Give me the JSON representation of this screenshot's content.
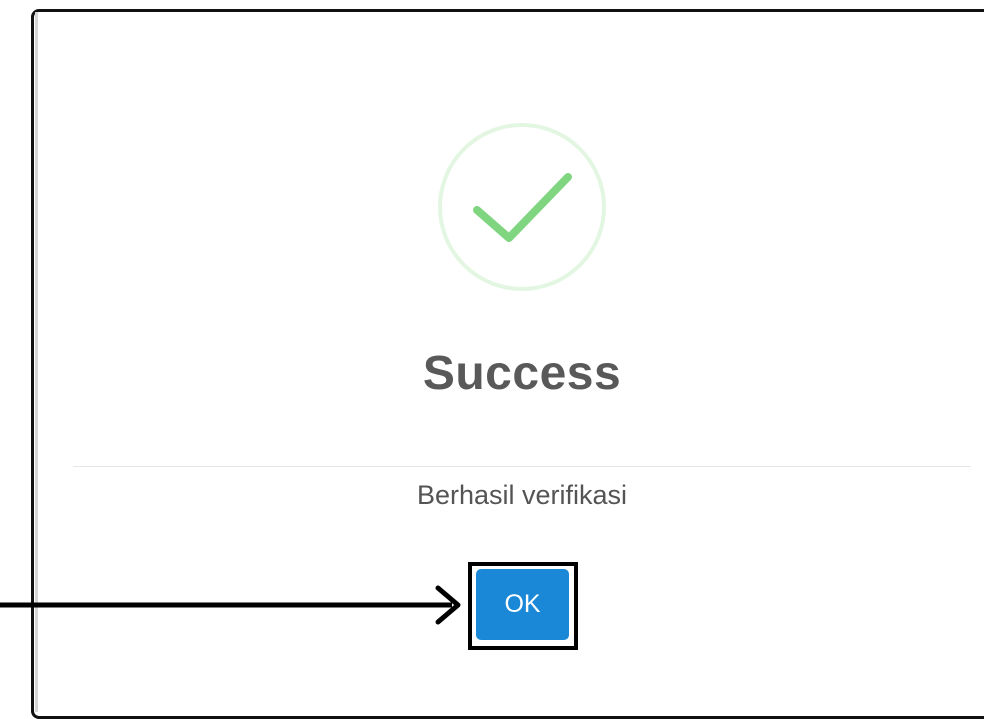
{
  "dialog": {
    "icon": "success-check-icon",
    "title": "Success",
    "message": "Berhasil verifikasi",
    "ok_label": "OK"
  },
  "annotation": {
    "icon": "pointer-arrow-icon"
  },
  "colors": {
    "check": "#7fd87f",
    "check_ring": "#dff5df",
    "button": "#1a88d6",
    "title": "#595959",
    "message": "#545454",
    "highlight": "#000000"
  }
}
